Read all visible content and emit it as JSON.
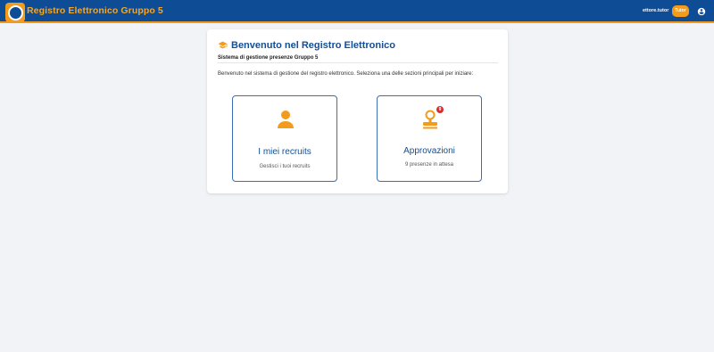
{
  "header": {
    "app_title": "Registro Elettronico Gruppo 5",
    "username": "ettore.tutor",
    "role_badge": "Tutor",
    "logo_icon": "school-logo-icon",
    "account_icon": "account-circle-icon"
  },
  "welcome": {
    "icon": "graduation-cap-icon",
    "title": "Benvenuto nel Registro Elettronico",
    "subtitle": "Sistema di gestione presenze Gruppo 5",
    "intro": "Benvenuto nel sistema di gestione del registro elettronico. Seleziona una delle sezioni principali per iniziare:"
  },
  "sections": [
    {
      "icon": "person-icon",
      "title": "I miei recruits",
      "description": "Gestisci i tuoi recruits"
    },
    {
      "icon": "approval-stamp-icon",
      "title": "Approvazioni",
      "description": "9 presenze in attesa",
      "badge": "9"
    }
  ],
  "colors": {
    "header_bg": "#0e4c96",
    "accent": "#f39b1c",
    "title_blue": "#124f96",
    "page_bg": "#f1f3f7",
    "badge_red": "#d32f2f"
  }
}
